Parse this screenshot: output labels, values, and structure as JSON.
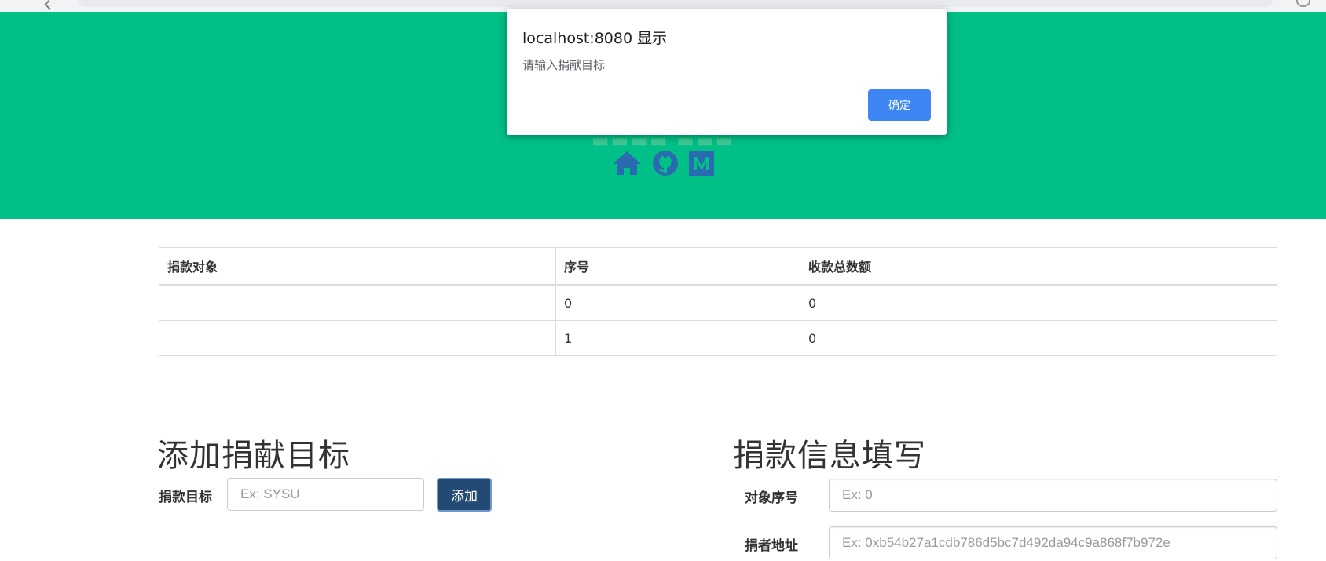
{
  "dialog": {
    "origin": "localhost:8080 显示",
    "message": "请输入捐献目标",
    "ok_label": "确定"
  },
  "header": {
    "icons": [
      "home-icon",
      "github-icon",
      "medium-icon"
    ],
    "background_color": "#00bf87",
    "icon_color": "#2a6ab0"
  },
  "table": {
    "headers": [
      "捐款对象",
      "序号",
      "收款总数额"
    ],
    "rows": [
      [
        "",
        "0",
        "0"
      ],
      [
        "",
        "1",
        "0"
      ]
    ]
  },
  "add_target": {
    "title": "添加捐献目标",
    "label": "捐款目标",
    "placeholder": "Ex: SYSU",
    "button_label": "添加",
    "button_color": "#224a74"
  },
  "donation_form": {
    "title": "捐款信息填写",
    "index_label": "对象序号",
    "index_placeholder": "Ex: 0",
    "address_label": "捐者地址",
    "address_placeholder": "Ex: 0xb54b27a1cdb786d5bc7d492da94c9a868f7b972e"
  }
}
